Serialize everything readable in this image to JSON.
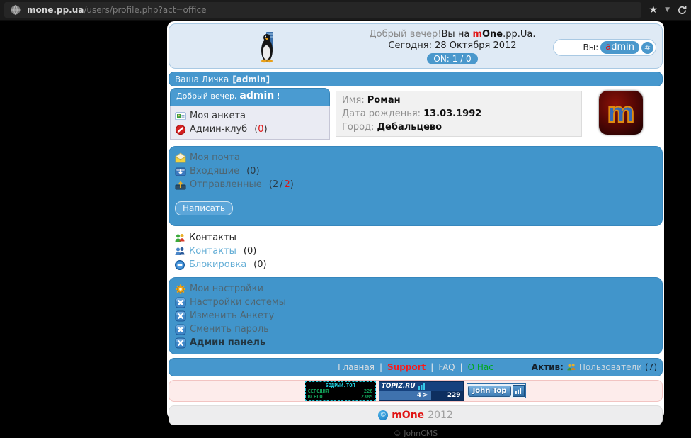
{
  "browser": {
    "url_host": "mone.pp.ua",
    "url_path": "/users/profile.php?act=office",
    "star": "★",
    "caret": "▼"
  },
  "punct": {
    "open": "(",
    "close": ")",
    "slash": "/",
    "pipe": "|"
  },
  "header_box": {
    "greeting": "Добрый вечер!",
    "you_are_on": "Вы на",
    "brand_m": "m",
    "brand_one": "One",
    "brand_tail": ".pp.Ua.",
    "today": "Сегодня: 28 Октября 2012",
    "online": "ON: 1 / 0",
    "you": "Вы:",
    "user_initial": "a",
    "user_rest": "dmin",
    "hash": "#"
  },
  "title_bar": {
    "label": "Ваша Личка",
    "user_bracket": "[admin]"
  },
  "panel": {
    "greet_small": "Добрый вечер,",
    "greet_user": "admin",
    "greet_bang": "!",
    "item_profile": "Моя анкета",
    "item_adminclub": "Админ-клуб",
    "adminclub_count": "0"
  },
  "info": {
    "name_label": "Имя:",
    "name_value": "Роман",
    "birth_label": "Дата рожденья:",
    "birth_value": "13.03.1992",
    "city_label": "Город:",
    "city_value": "Дебальцево",
    "avatar_letter": "m"
  },
  "mail": {
    "title": "Моя почта",
    "inbox": "Входящие",
    "inbox_count": "0",
    "sent": "Отправленные",
    "sent_total": "2",
    "sent_new": "2",
    "write_button": "Написать"
  },
  "contacts": {
    "title": "Контакты",
    "list_label": "Контакты",
    "list_count": "0",
    "block_label": "Блокировка",
    "block_count": "0"
  },
  "settings": {
    "title": "Мои настройки",
    "items": [
      "Настройки системы",
      "Изменить Анкету",
      "Сменить пароль",
      "Админ панель"
    ]
  },
  "footer_nav": {
    "home": "Главная",
    "support": "Support",
    "faq": "FAQ",
    "about": "О Нас",
    "active_label": "Актив:",
    "users_label": "Пользователи",
    "users_count": "7"
  },
  "banners": {
    "bodry_title": "БОДРЫЙ.ТОП",
    "bodry_today_label": "СЕГОДНЯ",
    "bodry_today_value": "228",
    "bodry_total_label": "ВСЕГО",
    "bodry_total_value": "2385",
    "topiz_title": "TOPIZ.RU",
    "topiz_left": "4",
    "topiz_arrow": ">",
    "topiz_right": "229",
    "johntop_label": "John Top"
  },
  "site_footer": {
    "copyright": "©",
    "brand": "mOne",
    "year": "2012",
    "cms": "© JohnCMS"
  },
  "colors": {
    "section_blue": "#4195cb",
    "header_bg": "#dfeaf5",
    "accent_red": "#e01414",
    "accent_green": "#00a81e",
    "banner_pink": "#fdeceb",
    "badge_blue": "#4a98cc"
  },
  "icons": {
    "globe-icon": "globe",
    "star-icon": "★",
    "caret-down-icon": "▼",
    "refresh-icon": "↻",
    "penguin-icon": "tux-penguin",
    "mail-open-icon": "envelope",
    "inbox-icon": "tray-down",
    "outbox-icon": "tray-up",
    "vcard-icon": "id-card",
    "deny-icon": "no-entry",
    "contacts-icon": "two-people",
    "block-icon": "circle-dash",
    "gear-icon": "gear",
    "tool-icon": "blue-x-square",
    "users-icon": "two-people-gold",
    "chart-bars-icon": "bar-chart",
    "copyright-icon": "©"
  }
}
